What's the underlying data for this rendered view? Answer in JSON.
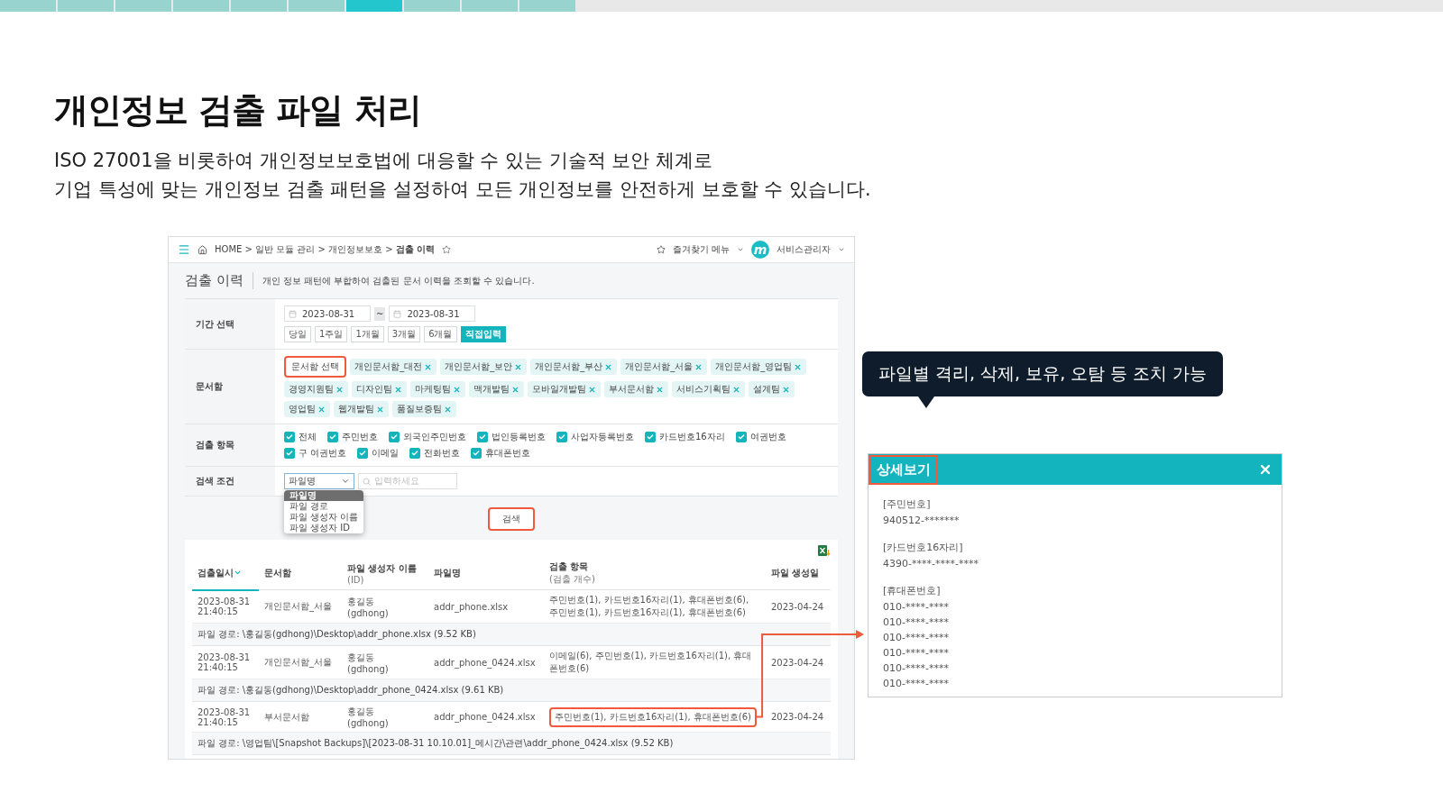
{
  "progress_steps": [
    {
      "selected": false
    },
    {
      "selected": false
    },
    {
      "selected": false
    },
    {
      "selected": false
    },
    {
      "selected": false
    },
    {
      "selected": false
    },
    {
      "selected": true
    },
    {
      "selected": false
    },
    {
      "selected": false
    },
    {
      "selected": false
    }
  ],
  "heading": {
    "title": "개인정보 검출 파일 처리",
    "description": [
      "ISO 27001을 비롯하여 개인정보보호법에 대응할 수 있는 기술적 보안 체계로",
      "기업 특성에 맞는 개인정보 검출 패턴을 설정하여 모든 개인정보를 안전하게 보호할 수 있습니다."
    ]
  },
  "app": {
    "breadcrumb": "HOME > 일반 모듈 관리 > 개인정보보호 > **검출 이력**",
    "favorites_menu": "즐겨찾기 메뉴",
    "logo_letter": "m",
    "user": "서비스관리자",
    "page_title": "검출 이력",
    "page_description": "개인 정보 패턴에 부합하여 검출된 문서 이력을 조회할 수 있습니다.",
    "period": {
      "label": "기간 선택",
      "start": "2023-08-31",
      "separator": "~",
      "end": "2023-08-31",
      "quick": [
        {
          "label": "당일",
          "selected": false
        },
        {
          "label": "1주일",
          "selected": false
        },
        {
          "label": "1개월",
          "selected": false
        },
        {
          "label": "3개월",
          "selected": false
        },
        {
          "label": "6개월",
          "selected": false
        },
        {
          "label": "직접입력",
          "selected": true
        }
      ]
    },
    "folders": {
      "label": "문서함",
      "select_button": {
        "label": "문서함 선택",
        "highlighted": true
      },
      "tags": [
        "개인문서함_대전",
        "개인문서함_보안",
        "개인문서함_부산",
        "개인문서함_서울",
        "개인문서함_영업팀",
        "경영지원팀",
        "디자인팀",
        "마케팅팀",
        "맥개발팀",
        "모바일개발팀",
        "부서문서함",
        "서비스기획팀",
        "설계팀",
        "영업팀",
        "웹개발팀",
        "품질보증팀"
      ]
    },
    "detect_items": {
      "label": "검출 항목",
      "options": [
        {
          "label": "전체",
          "checked": true
        },
        {
          "label": "주민번호",
          "checked": true
        },
        {
          "label": "외국인주민번호",
          "checked": true
        },
        {
          "label": "법인등록번호",
          "checked": true
        },
        {
          "label": "사업자등록번호",
          "checked": true
        },
        {
          "label": "카드번호16자리",
          "checked": true
        },
        {
          "label": "여권번호",
          "checked": true
        },
        {
          "label": "구 여권번호",
          "checked": true
        },
        {
          "label": "이메일",
          "checked": true
        },
        {
          "label": "전화번호",
          "checked": true
        },
        {
          "label": "휴대폰번호",
          "checked": true
        }
      ]
    },
    "condition": {
      "label": "검색 조건",
      "select": "파일명",
      "placeholder": "입력하세요",
      "options": [
        {
          "label": "파일명",
          "selected": true
        },
        {
          "label": "파일 경로",
          "selected": false
        },
        {
          "label": "파일 생성자 이름",
          "selected": false
        },
        {
          "label": "파일 생성자 ID",
          "selected": false
        }
      ]
    },
    "search_button": {
      "label": "검색",
      "highlighted": true
    },
    "table": {
      "columns": [
        {
          "label": "검출일시",
          "sorted": true
        },
        {
          "label": "문서함",
          "sorted": false
        },
        {
          "label": "파일 생성자 이름",
          "sub": "(ID)",
          "sorted": false
        },
        {
          "label": "파일명",
          "sorted": false
        },
        {
          "label": "검출 항목",
          "sub": "(검출 개수)",
          "sorted": false
        },
        {
          "label": "파일 생성일",
          "sorted": false
        }
      ],
      "rows": [
        {
          "datetime": "2023-08-31\n21:40:15",
          "folder": "개인문서함_서울",
          "creator": "홍길동\n(gdhong)",
          "file": "addr_phone.xlsx",
          "items": "주민번호(1), 카드번호16자리(1), 휴대폰번호(6), 주민번호(1), 카드번호16자리(1), 휴대폰번호(6)",
          "highlighted": false,
          "created": "2023-04-24",
          "path": "파일 경로: \\홍길동(gdhong)\\Desktop\\addr_phone.xlsx (9.52 KB)"
        },
        {
          "datetime": "2023-08-31\n21:40:15",
          "folder": "개인문서함_서울",
          "creator": "홍길동\n(gdhong)",
          "file": "addr_phone_0424.xlsx",
          "items": "이메일(6), 주민번호(1), 카드번호16자리(1), 휴대폰번호(6)",
          "highlighted": false,
          "created": "2023-04-24",
          "path": "파일 경로: \\홍길동(gdhong)\\Desktop\\addr_phone_0424.xlsx (9.61 KB)"
        },
        {
          "datetime": "2023-08-31\n21:40:15",
          "folder": "부서문서함",
          "creator": "홍길동\n(gdhong)",
          "file": "addr_phone_0424.xlsx",
          "items": "주민번호(1), 카드번호16자리(1), 휴대폰번호(6)",
          "highlighted": true,
          "created": "2023-04-24",
          "path": "파일 경로: \\영업팀\\[Snapshot Backups]\\[2023-08-31 10.10.01]_메시간\\관련\\addr_phone_0424.xlsx (9.52 KB)"
        }
      ]
    }
  },
  "tooltip": "파일별 격리, 삭제, 보유, 오탐 등 조치 가능",
  "detail": {
    "title": "상세보기",
    "highlighted": true,
    "sections": [
      {
        "label": "[주민번호]",
        "values": [
          "940512-*******"
        ]
      },
      {
        "label": "[카드번호16자리]",
        "values": [
          "4390-****-****-****"
        ]
      },
      {
        "label": "[휴대폰번호]",
        "values": [
          "010-****-****",
          "010-****-****",
          "010-****-****",
          "010-****-****",
          "010-****-****",
          "010-****-****"
        ]
      }
    ]
  }
}
